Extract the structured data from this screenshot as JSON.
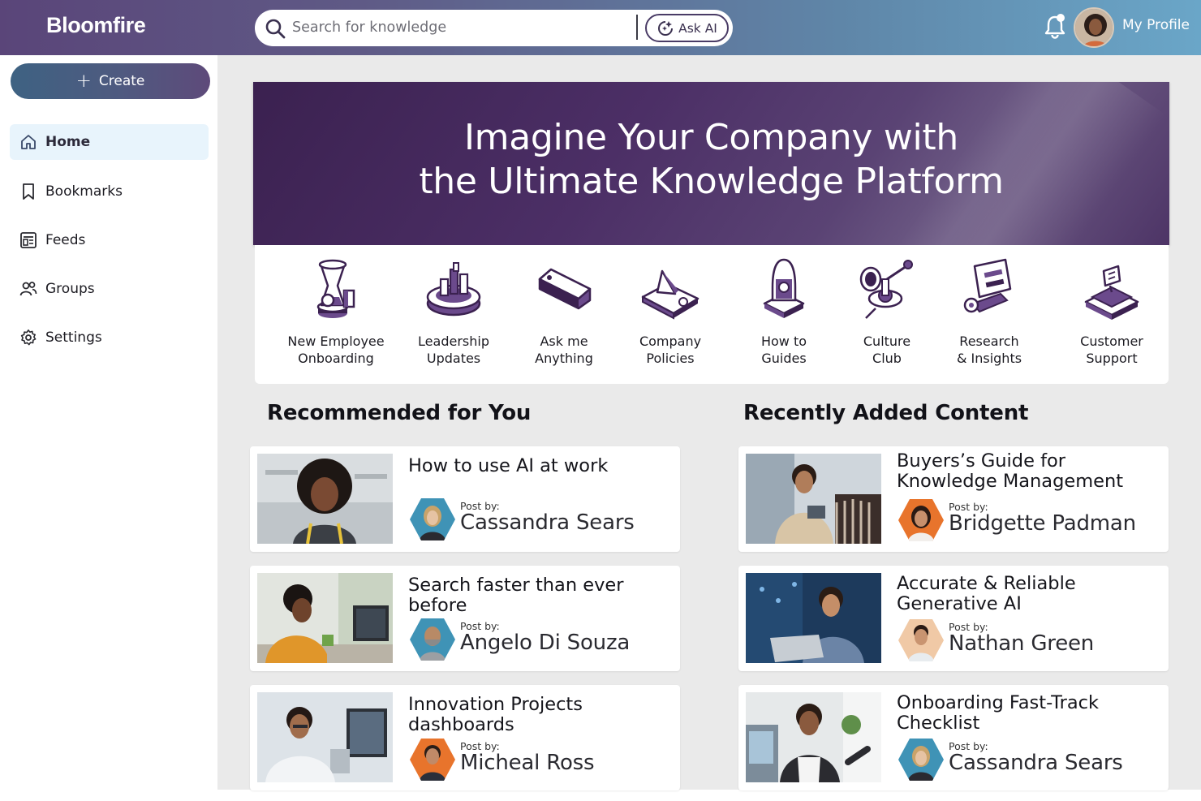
{
  "app": {
    "name": "Bloomfire"
  },
  "search": {
    "placeholder": "Search for knowledge",
    "ask_ai_label": "Ask AI"
  },
  "profile": {
    "label": "My Profile"
  },
  "sidebar": {
    "create_label": "Create",
    "items": [
      {
        "label": "Home",
        "icon": "home-icon",
        "active": true
      },
      {
        "label": "Bookmarks",
        "icon": "bookmark-icon"
      },
      {
        "label": "Feeds",
        "icon": "feeds-icon"
      },
      {
        "label": "Groups",
        "icon": "groups-icon"
      },
      {
        "label": "Settings",
        "icon": "gear-icon"
      }
    ]
  },
  "hero": {
    "line1": "Imagine Your Company with",
    "line2": "the Ultimate Knowledge Platform"
  },
  "categories": [
    {
      "line1": "New Employee",
      "line2": "Onboarding",
      "icon": "hourglass-icon"
    },
    {
      "line1": "Leadership",
      "line2": "Updates",
      "icon": "bar-chart-icon"
    },
    {
      "line1": "Ask me",
      "line2": "Anything",
      "icon": "tag-icon"
    },
    {
      "line1": "Company",
      "line2": "Policies",
      "icon": "policy-document-icon"
    },
    {
      "line1": "How to",
      "line2": "Guides",
      "icon": "lightbulb-icon"
    },
    {
      "line1": "Culture",
      "line2": "Club",
      "icon": "megaphone-icon"
    },
    {
      "line1": "Research",
      "line2": "& Insights",
      "icon": "research-icon"
    },
    {
      "line1": "Customer",
      "line2": "Support",
      "icon": "support-chat-icon"
    }
  ],
  "recommended": {
    "title": "Recommended for You",
    "cards": [
      {
        "title": "How to use AI at work",
        "post_by": "Post by:",
        "author": "Cassandra Sears"
      },
      {
        "title": "Search faster than ever before",
        "post_by": "Post by:",
        "author": "Angelo Di Souza"
      },
      {
        "title": "Innovation Projects dashboards",
        "post_by": "Post by:",
        "author": "Micheal Ross"
      }
    ]
  },
  "recent": {
    "title": "Recently Added Content",
    "cards": [
      {
        "title": "Buyers’s Guide for Knowledge Management",
        "post_by": "Post by:",
        "author": "Bridgette Padman"
      },
      {
        "title": "Accurate & Reliable Generative AI",
        "post_by": "Post by:",
        "author": "Nathan Green"
      },
      {
        "title": "Onboarding Fast-Track Checklist",
        "post_by": "Post by:",
        "author": "Cassandra Sears"
      }
    ]
  },
  "colors": {
    "brand_purple": "#4c2f66",
    "accent_blue": "#6aa6c8",
    "active_nav_bg": "#e8f4fc",
    "author_hex_blue": "#3f93b6",
    "author_hex_orange": "#e8742c"
  }
}
